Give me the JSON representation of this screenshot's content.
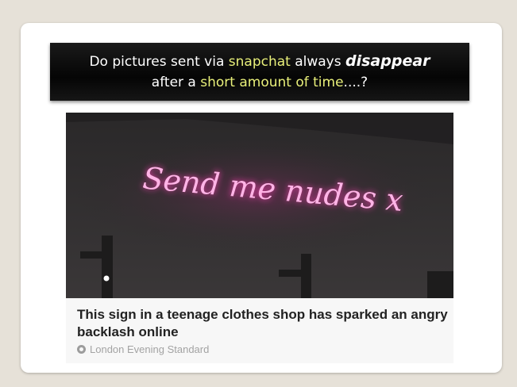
{
  "banner": {
    "part1": "Do pictures sent via ",
    "highlight1": "snapchat",
    "part2": " always ",
    "emphasis": "disappear",
    "part3": "after a ",
    "highlight2": "short amount of time",
    "part4": "....?",
    "highlight_color": "#e9f07a"
  },
  "image": {
    "neon_text": "Send me nudes x",
    "neon_color": "#ff5ec8"
  },
  "caption": {
    "title": "This sign in a teenage clothes shop has sparked an angry backlash online",
    "source": "London Evening Standard"
  }
}
